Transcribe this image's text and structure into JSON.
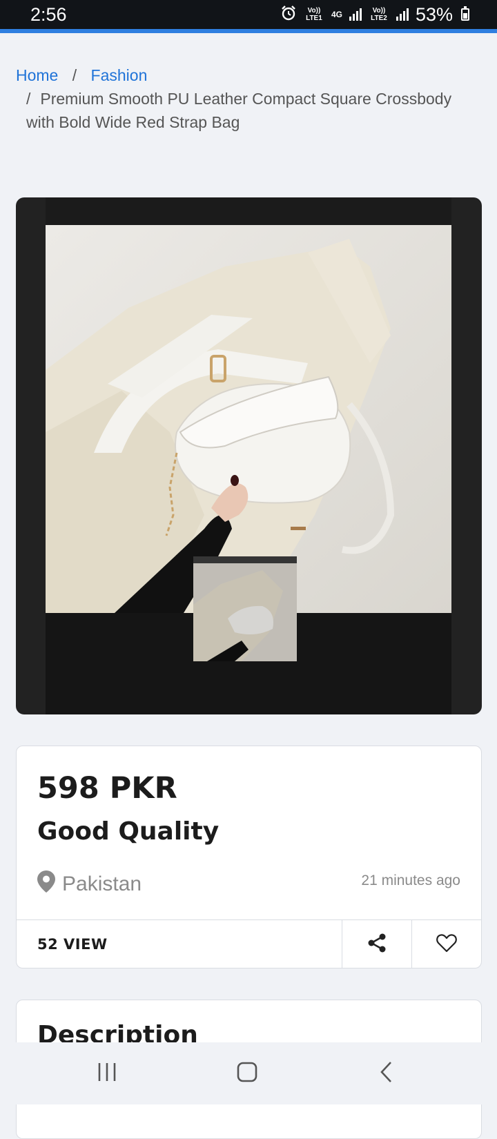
{
  "status_bar": {
    "time": "2:56",
    "sim1_label": "Vo)) LTE1",
    "net_type": "4G",
    "sim2_label": "Vo)) LTE2",
    "battery_percent": "53%",
    "icons": [
      "alarm-icon",
      "signal-icon",
      "battery-icon"
    ]
  },
  "breadcrumb": {
    "home": "Home",
    "separator": "/",
    "category": "Fashion",
    "product_line1": "Premium Smooth PU Leather Compact Square Crossbody",
    "product_line2": "with Bold Wide Red Strap Bag"
  },
  "listing": {
    "price": "598 PKR",
    "title": "Good Quality",
    "location": "Pakistan",
    "posted": "21 minutes ago",
    "views": "52 VIEW"
  },
  "description": {
    "heading": "Description"
  },
  "colors": {
    "accent": "#2f7fe0",
    "link": "#1f73d8",
    "background": "#f0f2f6"
  }
}
